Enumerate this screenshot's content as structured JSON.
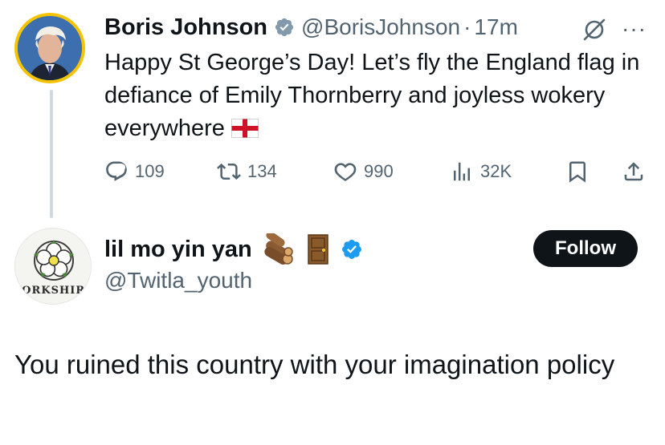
{
  "parent": {
    "author_name": "Boris Johnson",
    "handle": "@BorisJohnson",
    "separator": "·",
    "time": "17m",
    "text": "Happy St George’s Day! Let’s fly the England flag in defiance of Emily Thornberry and joyless wokery everywhere",
    "stats": {
      "replies": "109",
      "reposts": "134",
      "likes": "990",
      "views": "32K"
    },
    "icons": [
      "verified-grey-badge",
      "grok-icon",
      "more-icon",
      "england-flag-emoji",
      "reply-icon",
      "repost-icon",
      "like-icon",
      "views-icon",
      "bookmark-icon",
      "share-icon"
    ]
  },
  "reply": {
    "author_name": "lil mo yin yan",
    "handle": "@Twitla_youth",
    "follow_label": "Follow",
    "avatar_text": "YORKSHIRE",
    "text": "You ruined this country with your imagination policy",
    "icons": [
      "log-emoji",
      "door-emoji",
      "verified-blue-badge"
    ]
  },
  "colors": {
    "text": "#0f1419",
    "secondary": "#536471",
    "verified_blue": "#1d9bf0",
    "verified_grey": "#829aab",
    "follow_bg": "#0f1419"
  }
}
